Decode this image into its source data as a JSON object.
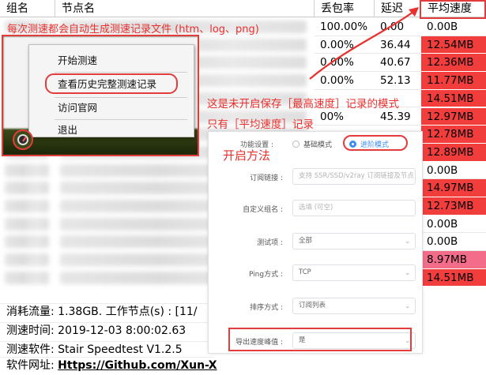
{
  "table": {
    "headers": [
      "组名",
      "节点名",
      "丢包率",
      "延迟",
      "平均速度"
    ],
    "rows": [
      {
        "loss": "100.00%",
        "ping": "0.00",
        "speed": "0.00B",
        "color": "#ffffff"
      },
      {
        "loss": "0.00%",
        "ping": "36.44",
        "speed": "12.54MB",
        "color": "#f23d3d"
      },
      {
        "loss": "0.00%",
        "ping": "40.67",
        "speed": "12.36MB",
        "color": "#f23d3d"
      },
      {
        "loss": "0.00%",
        "ping": "52.13",
        "speed": "11.77MB",
        "color": "#f23d3d"
      },
      {
        "loss": "",
        "ping": "",
        "speed": "14.51MB",
        "color": "#f23d3d"
      },
      {
        "loss": "00%",
        "ping": "45.39",
        "speed": "12.97MB",
        "color": "#f23d3d"
      },
      {
        "loss": "",
        "ping": "",
        "speed": "12.78MB",
        "color": "#f23d3d"
      },
      {
        "loss": "",
        "ping": "",
        "speed": "12.89MB",
        "color": "#f23d3d"
      },
      {
        "loss": "",
        "ping": "",
        "speed": "0.00B",
        "color": "#ffffff"
      },
      {
        "loss": "",
        "ping": "",
        "speed": "14.97MB",
        "color": "#f23d3d"
      },
      {
        "loss": "",
        "ping": "",
        "speed": "12.73MB",
        "color": "#f23d3d"
      },
      {
        "loss": "",
        "ping": "",
        "speed": "0.00B",
        "color": "#ffffff"
      },
      {
        "loss": "",
        "ping": "",
        "speed": "0.00B",
        "color": "#ffffff"
      },
      {
        "loss": "",
        "ping": "",
        "speed": "8.97MB",
        "color": "#f36d8a"
      },
      {
        "loss": "",
        "ping": "",
        "speed": "14.51MB",
        "color": "#f23d3d"
      }
    ]
  },
  "footer": {
    "traffic": "消耗流量: 1.38GB. 工作节点(s) : [11/",
    "time": "测速时间: 2019-12-03 8:00:02.63",
    "software": "测速软件: Stair Speedtest V1.2.5",
    "site_prefix": "软件网址: ",
    "site_link": "Https://Github.com/Xun-X"
  },
  "context_menu": {
    "items": [
      "开始测速",
      "查看历史完整测速记录",
      "访问官网",
      "退出"
    ]
  },
  "settings_panel": {
    "mode_label": "功能设置 :",
    "basic_mode": "基础模式",
    "advanced_mode": "进阶模式",
    "fields": [
      {
        "label": "订阅链接 :",
        "value": "支持 SSR/SSD/v2ray 订阅链接及节点",
        "placeholder": true,
        "dropdown": false
      },
      {
        "label": "自定义组名 :",
        "value": "选填 (可空)",
        "placeholder": true,
        "dropdown": false
      },
      {
        "label": "测试项 :",
        "value": "全部",
        "placeholder": false,
        "dropdown": true
      },
      {
        "label": "Ping方式 :",
        "value": "TCP",
        "placeholder": false,
        "dropdown": true
      },
      {
        "label": "排序方式 :",
        "value": "订阅列表",
        "placeholder": false,
        "dropdown": true
      },
      {
        "label": "导出速度峰值 :",
        "value": "是",
        "placeholder": false,
        "dropdown": true
      }
    ]
  },
  "annotations": {
    "auto_log": "每次测速都会自动生成测速记录文件 (htm、log、png)",
    "mode_note": "这是未开启保存［最高速度］记录的模式",
    "avg_note": "只有［平均速度］记录",
    "enable_method": "开启方法"
  },
  "colors": {
    "highlight_red": "#e23c3c",
    "speed_red": "#f23d3d",
    "speed_pink": "#f36d8a",
    "annotation_red": "#e8302e",
    "radio_blue": "#3d8bf5"
  }
}
